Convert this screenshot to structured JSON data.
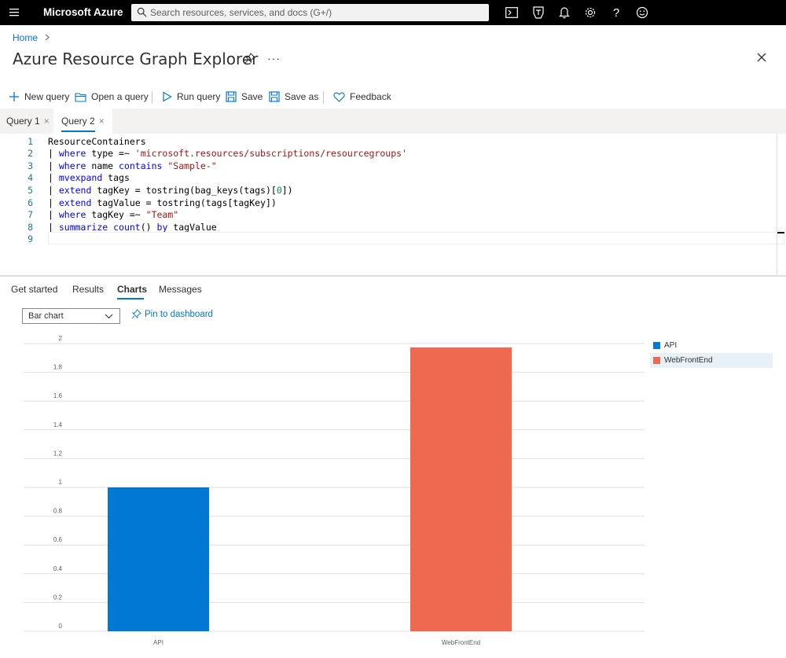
{
  "topbar": {
    "brand": "Microsoft Azure",
    "search_placeholder": "Search resources, services, and docs (G+/)",
    "icons": [
      "cloud-shell-icon",
      "directory-filter-icon",
      "notifications-icon",
      "settings-icon",
      "help-icon",
      "feedback-smiley-icon"
    ]
  },
  "breadcrumb": {
    "home": "Home"
  },
  "page": {
    "title": "Azure Resource Graph Explorer"
  },
  "toolbar": {
    "new_query": "New query",
    "open_query": "Open a query",
    "run_query": "Run query",
    "save": "Save",
    "save_as": "Save as",
    "feedback": "Feedback"
  },
  "query_tabs": [
    {
      "label": "Query 1",
      "active": false
    },
    {
      "label": "Query 2",
      "active": true
    }
  ],
  "editor": {
    "lines": [
      {
        "n": "1",
        "text": "ResourceContainers"
      },
      {
        "n": "2",
        "text": "| where type =~ 'microsoft.resources/subscriptions/resourcegroups'"
      },
      {
        "n": "3",
        "text": "| where name contains \"Sample-\""
      },
      {
        "n": "4",
        "text": "| mvexpand tags"
      },
      {
        "n": "5",
        "text": "| extend tagKey = tostring(bag_keys(tags)[0])"
      },
      {
        "n": "6",
        "text": "| extend tagValue = tostring(tags[tagKey])"
      },
      {
        "n": "7",
        "text": "| where tagKey =~ \"Team\""
      },
      {
        "n": "8",
        "text": "| summarize count() by tagValue"
      },
      {
        "n": "9",
        "text": ""
      }
    ]
  },
  "result_tabs": [
    "Get started",
    "Results",
    "Charts",
    "Messages"
  ],
  "result_tab_active": "Charts",
  "chart_controls": {
    "chart_type": "Bar chart",
    "pin_to_dashboard": "Pin to dashboard"
  },
  "colors": {
    "accent": "#0078d4",
    "api": "#0078d4",
    "webfrontend": "#ef6950",
    "topbar": "#000000"
  },
  "chart_data": {
    "type": "bar",
    "categories": [
      "API",
      "WebFrontEnd"
    ],
    "values": [
      1,
      2
    ],
    "colors": [
      "#0078d4",
      "#ef6950"
    ],
    "yticks": [
      "0",
      "0.2",
      "0.4",
      "0.6",
      "0.8",
      "1",
      "1.2",
      "1.4",
      "1.6",
      "1.8",
      "2"
    ],
    "ylim": [
      0,
      2
    ],
    "grid": true,
    "legend": [
      "API",
      "WebFrontEnd"
    ],
    "legend_position": "right"
  }
}
